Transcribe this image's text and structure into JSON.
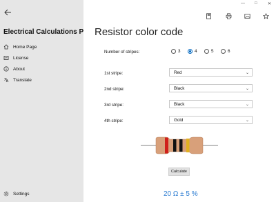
{
  "app": {
    "title": "Electrical Calculations PRO"
  },
  "window_controls": {
    "minimize": "—",
    "maximize": "□",
    "close": "✕"
  },
  "sidebar": {
    "items": [
      {
        "label": "Home Page",
        "icon": "home-icon"
      },
      {
        "label": "License",
        "icon": "license-icon"
      },
      {
        "label": "About",
        "icon": "info-icon"
      },
      {
        "label": "Translate",
        "icon": "translate-icon"
      }
    ],
    "settings_label": "Settings"
  },
  "toolbar": {
    "icons": [
      "calculator-icon",
      "print-icon",
      "image-icon",
      "favorite-star-icon"
    ]
  },
  "page": {
    "title": "Resistor color code"
  },
  "stripes": {
    "label": "Number of stripes:",
    "options": [
      "3",
      "4",
      "5",
      "6"
    ],
    "selected": "4"
  },
  "fields": [
    {
      "label": "1st stripe:",
      "value": "Red"
    },
    {
      "label": "2nd stripe:",
      "value": "Black"
    },
    {
      "label": "3rd stripe:",
      "value": "Black"
    },
    {
      "label": "4th stripe:",
      "value": "Gold"
    }
  ],
  "resistor": {
    "body_color": "#d8a07a",
    "band_colors": [
      "#d0201a",
      "#111111",
      "#111111",
      "#e0b020"
    ]
  },
  "calculate_label": "Calculate",
  "result": "20 Ω ± 5 %",
  "colors": {
    "accent": "#0067c0",
    "result_text": "#2a7bd1",
    "sidebar_bg": "#e6e6e6"
  }
}
